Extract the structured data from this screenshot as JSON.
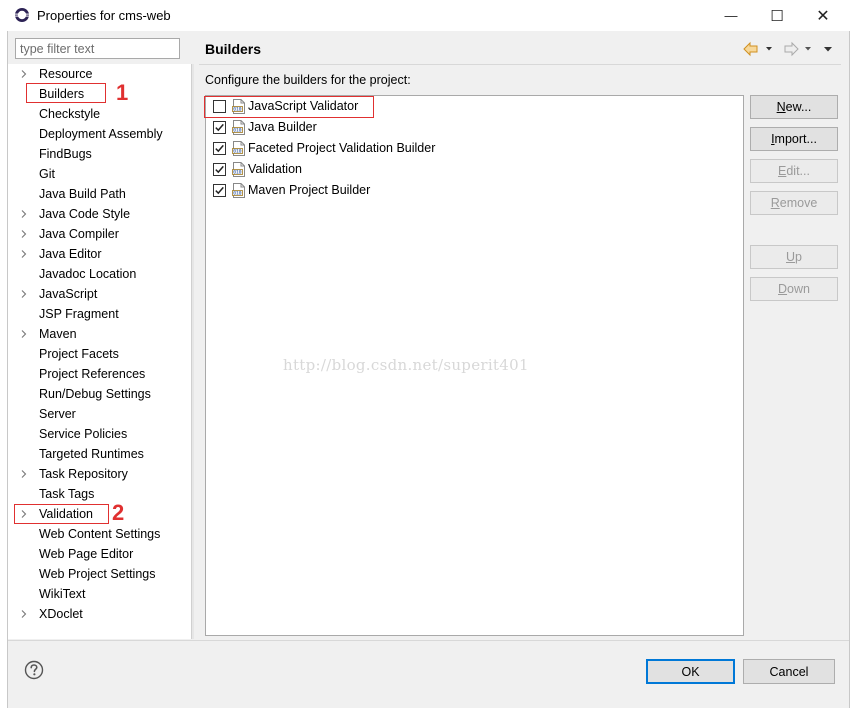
{
  "window": {
    "title": "Properties for cms-web",
    "minimize_glyph": "—",
    "maximize_glyph": "☐",
    "close_glyph": "✕"
  },
  "filter": {
    "placeholder": "type filter text",
    "value": ""
  },
  "tree": {
    "items": [
      {
        "label": "Resource",
        "expandable": true
      },
      {
        "label": "Builders",
        "expandable": false
      },
      {
        "label": "Checkstyle",
        "expandable": false
      },
      {
        "label": "Deployment Assembly",
        "expandable": false
      },
      {
        "label": "FindBugs",
        "expandable": false
      },
      {
        "label": "Git",
        "expandable": false
      },
      {
        "label": "Java Build Path",
        "expandable": false
      },
      {
        "label": "Java Code Style",
        "expandable": true
      },
      {
        "label": "Java Compiler",
        "expandable": true
      },
      {
        "label": "Java Editor",
        "expandable": true
      },
      {
        "label": "Javadoc Location",
        "expandable": false
      },
      {
        "label": "JavaScript",
        "expandable": true
      },
      {
        "label": "JSP Fragment",
        "expandable": false
      },
      {
        "label": "Maven",
        "expandable": true
      },
      {
        "label": "Project Facets",
        "expandable": false
      },
      {
        "label": "Project References",
        "expandable": false
      },
      {
        "label": "Run/Debug Settings",
        "expandable": false
      },
      {
        "label": "Server",
        "expandable": false
      },
      {
        "label": "Service Policies",
        "expandable": false
      },
      {
        "label": "Targeted Runtimes",
        "expandable": false
      },
      {
        "label": "Task Repository",
        "expandable": true
      },
      {
        "label": "Task Tags",
        "expandable": false
      },
      {
        "label": "Validation",
        "expandable": true
      },
      {
        "label": "Web Content Settings",
        "expandable": false
      },
      {
        "label": "Web Page Editor",
        "expandable": false
      },
      {
        "label": "Web Project Settings",
        "expandable": false
      },
      {
        "label": "WikiText",
        "expandable": false
      },
      {
        "label": "XDoclet",
        "expandable": true
      }
    ],
    "selected": "Builders"
  },
  "annotations": {
    "one": "1",
    "two": "2"
  },
  "page": {
    "title": "Builders",
    "description": "Configure the builders for the project:",
    "builders": [
      {
        "label": "JavaScript Validator",
        "checked": false
      },
      {
        "label": "Java Builder",
        "checked": true
      },
      {
        "label": "Faceted Project Validation Builder",
        "checked": true
      },
      {
        "label": "Validation",
        "checked": true
      },
      {
        "label": "Maven Project Builder",
        "checked": true
      }
    ],
    "watermark": "http://blog.csdn.net/superit401"
  },
  "buttons": {
    "new": {
      "mn": "N",
      "rest": "ew...",
      "enabled": true
    },
    "import": {
      "mn": "I",
      "rest": "mport...",
      "enabled": true
    },
    "edit": {
      "mn": "E",
      "rest": "dit...",
      "enabled": false
    },
    "remove": {
      "mn": "R",
      "rest": "emove",
      "enabled": false
    },
    "up": {
      "mn": "U",
      "rest": "p",
      "enabled": false
    },
    "down": {
      "mn": "D",
      "rest": "own",
      "enabled": false
    },
    "ok": "OK",
    "cancel": "Cancel"
  },
  "colors": {
    "annotation": "#e03030",
    "accent": "#0078d7",
    "nav_arrow": "#e8a33a"
  },
  "icons": [
    "app-icon",
    "back-icon",
    "forward-icon",
    "menu-icon",
    "builder-icon",
    "help-icon",
    "chevron-right-icon"
  ]
}
